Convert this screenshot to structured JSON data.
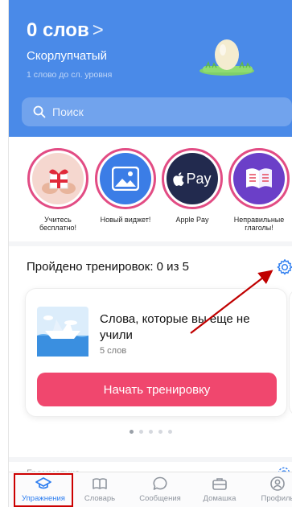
{
  "header": {
    "word_count": "0 слов",
    "chevron": ">",
    "rank": "Скорлупчатый",
    "next_level": "1 слово до сл. уровня",
    "search_placeholder": "Поиск"
  },
  "stories": [
    {
      "label": "Учитесь бесплатно!",
      "icon": "gift-icon"
    },
    {
      "label": "Новый виджет!",
      "icon": "widget-image-icon"
    },
    {
      "label": "Apple Pay",
      "icon": "apple-pay-icon",
      "logo_text": "Pay"
    },
    {
      "label": "Неправильные глаголы!",
      "icon": "book-icon"
    }
  ],
  "training": {
    "title": "Пройдено тренировок: 0 из 5",
    "card_title": "Слова, которые вы еще не учили",
    "card_sub": "5 слов",
    "start_label": "Начать тренировку"
  },
  "grammar": {
    "title": "Грамматика"
  },
  "tabs": [
    {
      "label": "Упражнения",
      "icon": "graduation-cap-icon",
      "active": true
    },
    {
      "label": "Словарь",
      "icon": "book-open-icon"
    },
    {
      "label": "Сообщения",
      "icon": "chat-bubble-icon"
    },
    {
      "label": "Домашка",
      "icon": "briefcase-icon"
    },
    {
      "label": "Профиль",
      "icon": "profile-icon"
    }
  ],
  "colors": {
    "header_blue": "#4a8ae8",
    "accent_pink": "#f0476e",
    "story_ring": "#e24c84",
    "active_tab": "#2e7ef0",
    "annotation_red": "#c00000"
  },
  "carousel": {
    "pages": 5,
    "active": 1
  }
}
